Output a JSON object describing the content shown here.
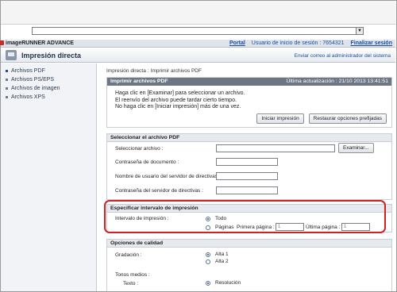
{
  "header": {
    "brand": "imageRUNNER ADVANCE",
    "portal": "Portal",
    "user_label": "Usuario de inicio de sesión : 7654321",
    "logout": "Finalizar sesión"
  },
  "titlebar": {
    "title": "Impresión directa",
    "mail_link": "Enviar correo al administrador del sistema"
  },
  "sidebar": {
    "items": [
      {
        "label": "Archivos PDF"
      },
      {
        "label": "Archivos PS/EPS"
      },
      {
        "label": "Archivos de imagen"
      },
      {
        "label": "Archivos XPS"
      }
    ]
  },
  "breadcrumb": {
    "first": "Impresión directa",
    "sep": ":",
    "second": "Imprimir archivos PDF"
  },
  "print_panel": {
    "title": "Imprimir archivos PDF",
    "updated": "Última actualización : 21/10 2013 13:41:51",
    "line1": "Haga clic en [Examinar] para seleccionar un archivo.",
    "line2": "El reenvío del archivo puede tardar cierto tiempo.",
    "line3": "No haga clic en [Iniciar impresión] más de una vez.",
    "start_button": "Iniciar impresión",
    "restore_button": "Restaurar opciones prefijadas"
  },
  "select_panel": {
    "title": "Seleccionar el archivo PDF",
    "select_file_label": "Seleccionar archivo :",
    "browse_button": "Examinar...",
    "doc_password_label": "Contraseña de documento :",
    "policy_user_label": "Nombre de usuario del servidor de directivas :",
    "policy_password_label": "Contraseña del servidor de directivas :"
  },
  "range_panel": {
    "title": "Especificar intervalo de impresión",
    "range_label": "Intervalo de impresión :",
    "all_option": "Todo",
    "pages_option": "Páginas",
    "first_page_label": "Primera página :",
    "first_page_value": "1",
    "last_page_label": "Última página :",
    "last_page_value": "1"
  },
  "quality_panel": {
    "title": "Opciones de calidad",
    "gradation_label": "Gradación :",
    "gradation_opt1": "Alta 1",
    "gradation_opt2": "Alta 2",
    "halftones_label": "Tonos medios :",
    "text_label": "Texto :",
    "text_option": "Resolución"
  }
}
